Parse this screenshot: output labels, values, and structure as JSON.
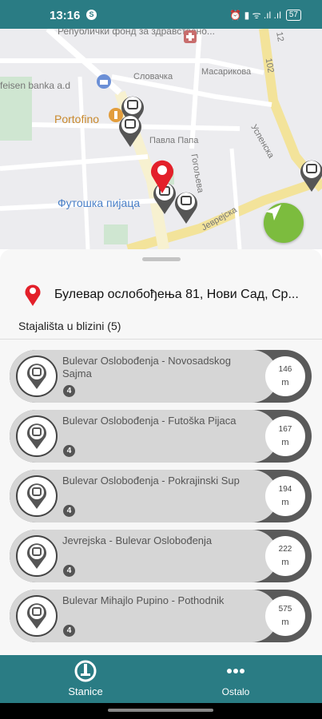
{
  "status_bar": {
    "time": "13:16",
    "app_badge": "S",
    "indicators": "⏰ ▮ ᯤ .ıl .ıl",
    "battery": "57"
  },
  "map": {
    "labels": {
      "street_top": "Републички фонд за здравствено...",
      "bank": "feisen banka a.d",
      "portofino": "Portofino",
      "slovacka": "Словачка",
      "masarikova": "Масарикова",
      "pavla_papa": "Павла Папа",
      "market": "Футошка пијаца",
      "jevrejska": "Јеврејска",
      "uspenska": "Успенска",
      "gogoljeva": "Гогољева",
      "road_102": "102",
      "road_12": "12"
    },
    "icons": [
      "bus-marker-icon",
      "location-pin-icon",
      "navigate-arrow-icon"
    ]
  },
  "sheet": {
    "address": "Булевар ослобођења 81, Нови Сад, Ср...",
    "nearby_title": "Stajališta u blizini (5)",
    "stops": [
      {
        "name": "Bulevar Oslobođenja - Novosadskog Sajma",
        "lines": "4",
        "distance": "146",
        "unit": "m"
      },
      {
        "name": "Bulevar Oslobođenja - Futoška Pijaca",
        "lines": "4",
        "distance": "167",
        "unit": "m"
      },
      {
        "name": "Bulevar Oslobođenja - Pokrajinski Sup",
        "lines": "4",
        "distance": "194",
        "unit": "m"
      },
      {
        "name": "Jevrejska - Bulevar Oslobođenja",
        "lines": "4",
        "distance": "222",
        "unit": "m"
      },
      {
        "name": "Bulevar Mihajlo Pupino - Pothodnik",
        "lines": "4",
        "distance": "575",
        "unit": "m"
      }
    ]
  },
  "bottom_nav": {
    "stanice": "Stanice",
    "ostalo": "Ostalo"
  },
  "colors": {
    "primary": "#2a7c84",
    "accent_green": "#7cbc3e",
    "pin_red": "#e3202a"
  }
}
